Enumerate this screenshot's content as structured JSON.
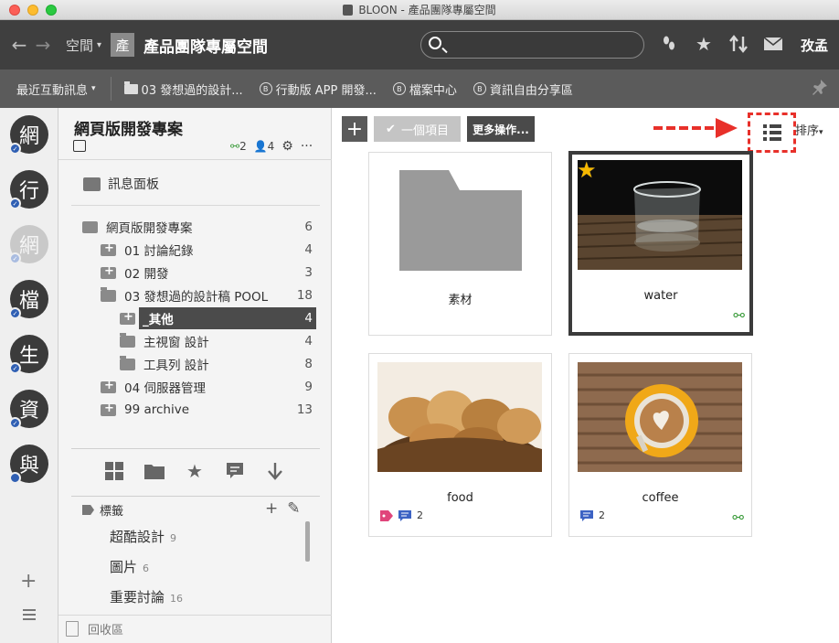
{
  "window": {
    "title": "BLOON - 產品團隊專屬空間"
  },
  "toolbar": {
    "space_menu": "空間",
    "space_badge": "產",
    "space_title": "產品團隊專屬空間",
    "search_placeholder": "",
    "user_name": "孜孟"
  },
  "bookmarks": {
    "recent": "最近互動訊息",
    "items": [
      {
        "label": "03 發想過的設計...",
        "icon": "folder-icon"
      },
      {
        "label": "行動版 APP 開發...",
        "icon": "bloon-circle-icon"
      },
      {
        "label": "檔案中心",
        "icon": "bloon-circle-icon"
      },
      {
        "label": "資訊自由分享區",
        "icon": "bloon-circle-icon"
      }
    ]
  },
  "rail": {
    "items": [
      {
        "char": "網",
        "dim": false
      },
      {
        "char": "行",
        "dim": false
      },
      {
        "char": "網",
        "dim": true
      },
      {
        "char": "檔",
        "dim": false
      },
      {
        "char": "生",
        "dim": false
      },
      {
        "char": "資",
        "dim": false
      },
      {
        "char": "與",
        "dim": false
      }
    ],
    "add_label": "+"
  },
  "project": {
    "title": "網頁版開發專案",
    "link_count": "2",
    "member_count": "4",
    "message_board": "訊息面板",
    "tree": [
      {
        "label": "網頁版開發專案",
        "count": "6",
        "indent": 0,
        "icon": "check-folder"
      },
      {
        "label": "01 討論紀錄",
        "count": "4",
        "indent": 1,
        "icon": "plus"
      },
      {
        "label": "02 開發",
        "count": "3",
        "indent": 1,
        "icon": "plus"
      },
      {
        "label": "03 發想過的設計稿 POOL",
        "count": "18",
        "indent": 1,
        "icon": "open"
      },
      {
        "label": "_其他",
        "count": "4",
        "indent": 2,
        "icon": "plus",
        "selected": true
      },
      {
        "label": "主視窗 設計",
        "count": "4",
        "indent": 2,
        "icon": "folder"
      },
      {
        "label": "工具列 設計",
        "count": "8",
        "indent": 2,
        "icon": "folder"
      },
      {
        "label": "04 伺服器管理",
        "count": "9",
        "indent": 1,
        "icon": "plus"
      },
      {
        "label": "99 archive",
        "count": "13",
        "indent": 1,
        "icon": "plus"
      }
    ],
    "tags_header": "標籤",
    "tags": [
      {
        "label": "超酷設計",
        "count": "9"
      },
      {
        "label": "圖片",
        "count": "6"
      },
      {
        "label": "重要討論",
        "count": "16"
      }
    ],
    "trash": "回收區"
  },
  "main": {
    "count_button": "一個項目",
    "more_button": "更多操作...",
    "sort_label": "排序",
    "cards": [
      {
        "name": "素材",
        "type": "folder"
      },
      {
        "name": "water",
        "type": "image",
        "selected": true,
        "starred": true,
        "linked": true
      },
      {
        "name": "food",
        "type": "image",
        "tag": true,
        "comments": "2"
      },
      {
        "name": "coffee",
        "type": "image",
        "comments": "2",
        "linked": true
      }
    ]
  },
  "colors": {
    "toolbar": "#3f3f3f",
    "bookmarks": "#5b5b5b",
    "selection": "#4b4b4b",
    "link_green": "#3a9b3a",
    "tag_pink": "#e0457b",
    "comment_blue": "#3d63c4",
    "annotation_red": "#e8302a",
    "star": "#f5b800"
  }
}
